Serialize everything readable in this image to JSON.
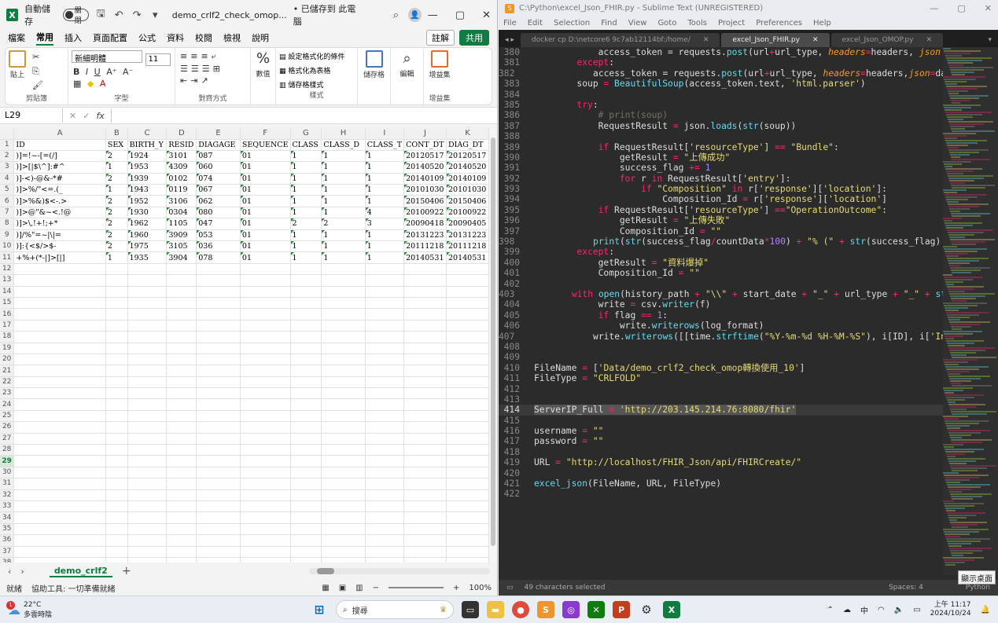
{
  "excel": {
    "title_bar": {
      "autosave": "自動儲存",
      "toggle": "關閉",
      "filename": "demo_crlf2_check_omop...",
      "saved": "• 已儲存到 此電腦"
    },
    "tabs": [
      "檔案",
      "常用",
      "插入",
      "頁面配置",
      "公式",
      "資料",
      "校閱",
      "檢視",
      "說明"
    ],
    "active_tab": "常用",
    "comment": "註解",
    "share": "共用",
    "ribbon": {
      "paste": "貼上",
      "font_name": "新細明體",
      "font_size": "11",
      "cond_format": "設定格式化的條件",
      "table_format": "格式化為表格",
      "cell_styles": "儲存格樣式",
      "cells": "儲存格",
      "edit": "編輯",
      "addins": "增益集",
      "percent": "數值",
      "groups": [
        "剪貼簿",
        "字型",
        "對齊方式",
        "樣式",
        "增益集"
      ]
    },
    "namebox": "L29",
    "fx": "fx",
    "columns": [
      "A",
      "B",
      "C",
      "D",
      "E",
      "F",
      "G",
      "H",
      "I",
      "J",
      "K"
    ],
    "rows": [
      [
        "ID",
        "SEX",
        "BIRTH_Y",
        "RESID",
        "DIAGAGE",
        "SEQUENCE",
        "CLASS",
        "CLASS_D",
        "CLASS_T",
        "CONT_DT",
        "DIAG_DT"
      ],
      [
        ")]=!~-[=(/]",
        "2",
        "1924",
        "3101",
        "087",
        "01",
        "1",
        "1",
        "1",
        "20120517",
        "20120517"
      ],
      [
        ")]>[|$\\^]:#^",
        "1",
        "1953",
        "4309",
        "060",
        "01",
        "1",
        "1",
        "1",
        "20140520",
        "20140520"
      ],
      [
        ")]-<)-@&-*#",
        "2",
        "1939",
        "0102",
        "074",
        "01",
        "1",
        "1",
        "1",
        "20140109",
        "20140109"
      ],
      [
        ")]>%/\"<=.(_",
        "1",
        "1943",
        "0119",
        "067",
        "01",
        "1",
        "1",
        "1",
        "20101030",
        "20101030"
      ],
      [
        ")]>%&)$<-.>",
        "2",
        "1952",
        "3106",
        "062",
        "01",
        "1",
        "1",
        "1",
        "20150406",
        "20150406"
      ],
      [
        ")]>@\"&~<.!@",
        "2",
        "1930",
        "0304",
        "080",
        "01",
        "1",
        "1",
        "4",
        "20100922",
        "20100922"
      ],
      [
        ")]>\\,!+!;+*",
        "2",
        "1962",
        "1105",
        "047",
        "01",
        "2",
        "2",
        "3",
        "20090418",
        "20090405"
      ],
      [
        ")]/%\"=~|\\|=",
        "2",
        "1960",
        "3909",
        "053",
        "01",
        "1",
        "1",
        "1",
        "20131223",
        "20131223"
      ],
      [
        ")]:{<$/>$-",
        "2",
        "1975",
        "3105",
        "036",
        "01",
        "1",
        "1",
        "1",
        "20111218",
        "20111218"
      ],
      [
        "+%+(*-|]>[|]",
        "1",
        "1935",
        "3904",
        "078",
        "01",
        "1",
        "1",
        "1",
        "20140531",
        "20140531"
      ]
    ],
    "row_count": 38,
    "selected_row": "29",
    "sheet": "demo_crlf2",
    "status": {
      "ready": "就緒",
      "accessibility": "協助工具: 一切準備就緒",
      "zoom": "100%"
    }
  },
  "sublime": {
    "title": "C:\\Python\\excel_Json_FHIR.py - Sublime Text (UNREGISTERED)",
    "menu": [
      "File",
      "Edit",
      "Selection",
      "Find",
      "View",
      "Goto",
      "Tools",
      "Project",
      "Preferences",
      "Help"
    ],
    "tabs": [
      "docker cp D:\\netcore6 9c7ab12114bf:/home/",
      "excel_Json_FHIR.py",
      "excel_Json_OMOP.py"
    ],
    "active_tab": "excel_Json_FHIR.py",
    "current_line": "414",
    "status_left": "49 characters selected",
    "spaces": "Spaces: 4",
    "syntax": "Python",
    "desktop": "顯示桌面"
  },
  "taskbar": {
    "temp": "22°C",
    "weather": "多雲時陰",
    "search": "搜尋",
    "time": "上午 11:17",
    "date": "2024/10/24",
    "ime": "中",
    "badge": "1"
  }
}
